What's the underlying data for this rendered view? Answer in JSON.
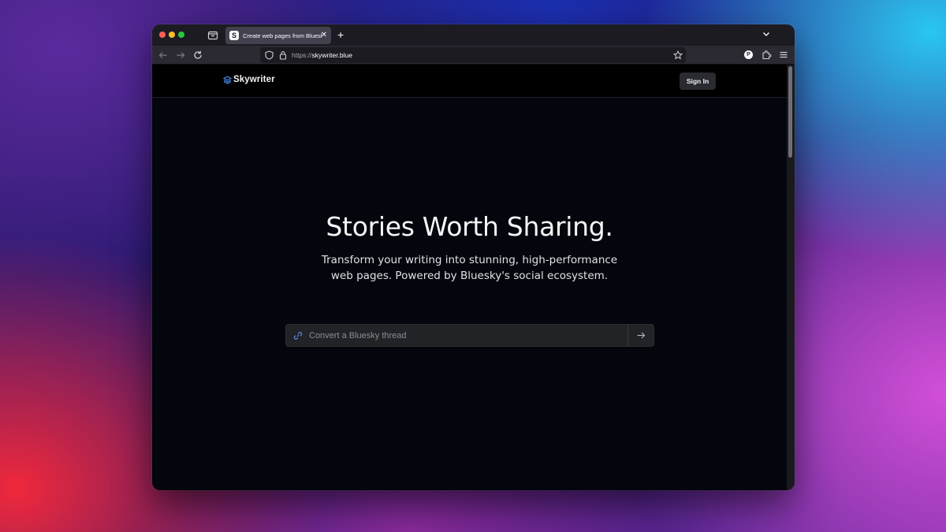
{
  "browser": {
    "tab": {
      "favicon": "S",
      "title": "Create web pages from Bluesky"
    },
    "url": {
      "scheme": "https://",
      "host": "skywriter.blue"
    },
    "extension_badge": "P"
  },
  "site": {
    "logo_text": "Skywriter",
    "signin_label": "Sign In",
    "accent_color": "#4a8ef0"
  },
  "hero": {
    "title": "Stories Worth Sharing.",
    "subtitle": "Transform your writing into stunning, high-performance web pages. Powered by Bluesky's social ecosystem."
  },
  "convert": {
    "placeholder": "Convert a Bluesky thread",
    "value": ""
  }
}
